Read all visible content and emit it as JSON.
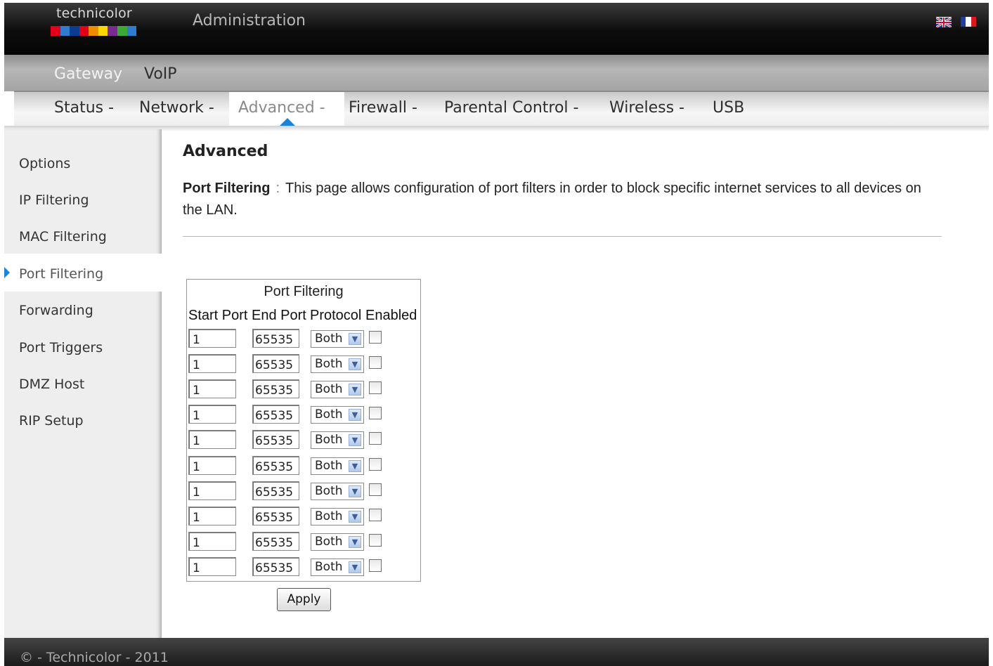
{
  "header": {
    "logo_text": "technicolor",
    "title": "Administration",
    "lang_flags": [
      "uk-flag-icon",
      "fr-flag-icon"
    ]
  },
  "nav_primary": [
    {
      "label": "Gateway",
      "active": true
    },
    {
      "label": "VoIP",
      "active": false
    }
  ],
  "nav_secondary": [
    {
      "label": "Status -"
    },
    {
      "label": "Network -"
    },
    {
      "label": "Advanced -",
      "active": true
    },
    {
      "label": "Firewall -"
    },
    {
      "label": "Parental Control -"
    },
    {
      "label": "Wireless -"
    },
    {
      "label": "USB"
    }
  ],
  "sidebar": {
    "items": [
      {
        "label": "Options"
      },
      {
        "label": "IP Filtering"
      },
      {
        "label": "MAC Filtering"
      },
      {
        "label": "Port Filtering",
        "active": true
      },
      {
        "label": "Forwarding"
      },
      {
        "label": "Port Triggers"
      },
      {
        "label": "DMZ Host"
      },
      {
        "label": "RIP Setup"
      }
    ]
  },
  "main": {
    "title": "Advanced",
    "desc_label": "Port Filtering",
    "desc_colon": ":",
    "desc_text": "This page allows configuration of port filters in order to block specific internet services to all devices on the LAN.",
    "table": {
      "caption": "Port Filtering",
      "headers": [
        "Start Port",
        "End Port",
        "Protocol",
        "Enabled"
      ],
      "rows": [
        {
          "start": "1",
          "end": "65535",
          "protocol": "Both",
          "enabled": false
        },
        {
          "start": "1",
          "end": "65535",
          "protocol": "Both",
          "enabled": false
        },
        {
          "start": "1",
          "end": "65535",
          "protocol": "Both",
          "enabled": false
        },
        {
          "start": "1",
          "end": "65535",
          "protocol": "Both",
          "enabled": false
        },
        {
          "start": "1",
          "end": "65535",
          "protocol": "Both",
          "enabled": false
        },
        {
          "start": "1",
          "end": "65535",
          "protocol": "Both",
          "enabled": false
        },
        {
          "start": "1",
          "end": "65535",
          "protocol": "Both",
          "enabled": false
        },
        {
          "start": "1",
          "end": "65535",
          "protocol": "Both",
          "enabled": false
        },
        {
          "start": "1",
          "end": "65535",
          "protocol": "Both",
          "enabled": false
        },
        {
          "start": "1",
          "end": "65535",
          "protocol": "Both",
          "enabled": false
        }
      ]
    },
    "apply_label": "Apply"
  },
  "footer": {
    "text": "© - Technicolor - 2011"
  },
  "colors": {
    "accent": "#1a85d8",
    "header_bg": "#0c0c0c",
    "sidebar_bg": "#eeeeee"
  }
}
